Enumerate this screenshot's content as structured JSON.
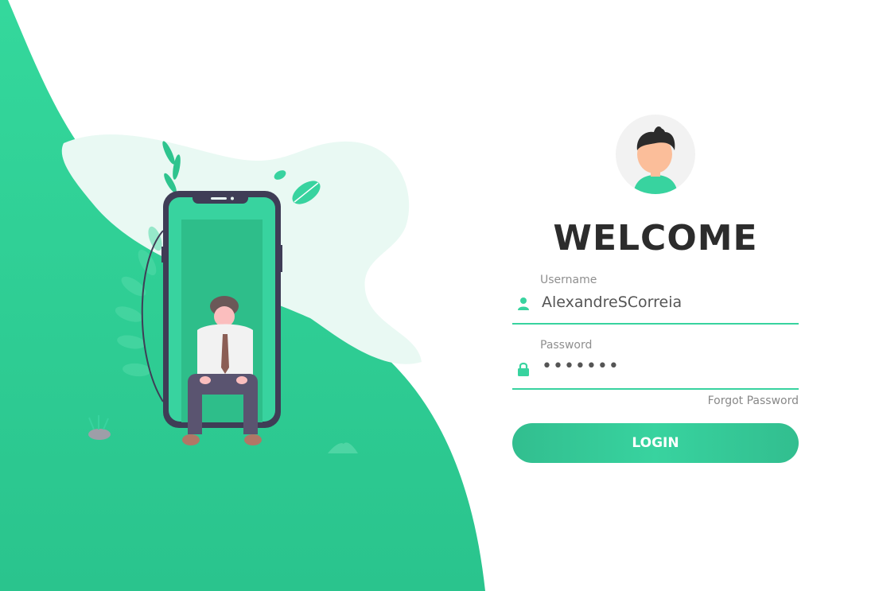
{
  "colors": {
    "accent": "#38d39f",
    "accent_dark": "#32be8f",
    "text_dark": "#2c2c2c",
    "text_muted": "#8f8f8f",
    "phone_frame": "#3f3d56"
  },
  "illustration": {
    "icon": "person-with-phone-illustration-icon"
  },
  "login": {
    "avatar_icon": "user-avatar-icon",
    "title": "WELCOME",
    "username": {
      "label": "Username",
      "value": "AlexandreSCorreia",
      "icon": "user-icon"
    },
    "password": {
      "label": "Password",
      "value": "•••••••",
      "icon": "lock-icon"
    },
    "forgot_label": "Forgot Password",
    "button_label": "LOGIN"
  }
}
